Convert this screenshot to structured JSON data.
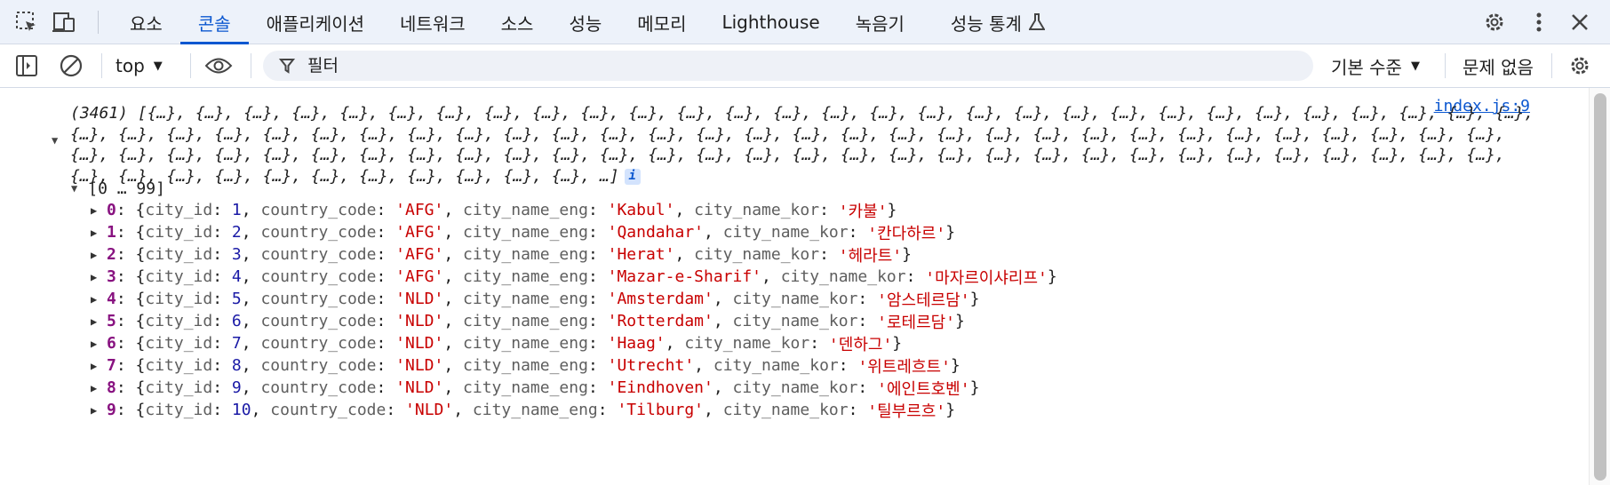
{
  "tabbar": {
    "tabs": [
      {
        "label": "요소"
      },
      {
        "label": "콘솔"
      },
      {
        "label": "애플리케이션"
      },
      {
        "label": "네트워크"
      },
      {
        "label": "소스"
      },
      {
        "label": "성능"
      },
      {
        "label": "메모리"
      },
      {
        "label": "Lighthouse"
      },
      {
        "label": "녹음기"
      },
      {
        "label": "성능 통계"
      }
    ],
    "active_tab": "콘솔"
  },
  "toolbar": {
    "context": "top",
    "filter_placeholder": "필터",
    "level": "기본 수준",
    "issues": "문제 없음"
  },
  "console": {
    "source": "index.js:9",
    "array_summary": "(3461) [{…}, {…}, {…}, {…}, {…}, {…}, {…}, {…}, {…}, {…}, {…}, {…}, {…}, {…}, {…}, {…}, {…}, {…}, {…}, {…}, {…}, {…}, {…}, {…}, {…}, {…}, {…}, {…}, {…}, {…}, {…}, {…}, {…}, {…}, {…}, {…}, {…}, {…}, {…}, {…}, {…}, {…}, {…}, {…}, {…}, {…}, {…}, {…}, {…}, {…}, {…}, {…}, {…}, {…}, {…}, {…}, {…}, {…}, {…}, {…}, {…}, {…}, {…}, {…}, {…}, {…}, {…}, {…}, {…}, {…}, {…}, {…}, {…}, {…}, {…}, {…}, {…}, {…}, {…}, {…}, {…}, {…}, {…}, {…}, {…}, {…}, {…}, {…}, {…}, {…}, {…}, {…}, {…}, {…}, {…}, {…}, {…}, {…}, {…}, {…}, …]",
    "info_badge": "i",
    "group_label": "[0 … 99]",
    "rows": [
      {
        "index": "0",
        "city_id": "1",
        "country_code": "'AFG'",
        "city_name_eng": "'Kabul'",
        "city_name_kor": "'카불'"
      },
      {
        "index": "1",
        "city_id": "2",
        "country_code": "'AFG'",
        "city_name_eng": "'Qandahar'",
        "city_name_kor": "'칸다하르'"
      },
      {
        "index": "2",
        "city_id": "3",
        "country_code": "'AFG'",
        "city_name_eng": "'Herat'",
        "city_name_kor": "'헤라트'"
      },
      {
        "index": "3",
        "city_id": "4",
        "country_code": "'AFG'",
        "city_name_eng": "'Mazar-e-Sharif'",
        "city_name_kor": "'마자르이샤리프'"
      },
      {
        "index": "4",
        "city_id": "5",
        "country_code": "'NLD'",
        "city_name_eng": "'Amsterdam'",
        "city_name_kor": "'암스테르담'"
      },
      {
        "index": "5",
        "city_id": "6",
        "country_code": "'NLD'",
        "city_name_eng": "'Rotterdam'",
        "city_name_kor": "'로테르담'"
      },
      {
        "index": "6",
        "city_id": "7",
        "country_code": "'NLD'",
        "city_name_eng": "'Haag'",
        "city_name_kor": "'덴하그'"
      },
      {
        "index": "7",
        "city_id": "8",
        "country_code": "'NLD'",
        "city_name_eng": "'Utrecht'",
        "city_name_kor": "'위트레흐트'"
      },
      {
        "index": "8",
        "city_id": "9",
        "country_code": "'NLD'",
        "city_name_eng": "'Eindhoven'",
        "city_name_kor": "'에인트호벤'"
      },
      {
        "index": "9",
        "city_id": "10",
        "country_code": "'NLD'",
        "city_name_eng": "'Tilburg'",
        "city_name_kor": "'틸부르흐'"
      }
    ],
    "keys": {
      "city_id": "city_id",
      "country_code": "country_code",
      "city_name_eng": "city_name_eng",
      "city_name_kor": "city_name_kor"
    }
  },
  "colors": {
    "accent": "#0b57d0",
    "index": "#881280",
    "string": "#c80000",
    "number": "#1a1aa6"
  }
}
